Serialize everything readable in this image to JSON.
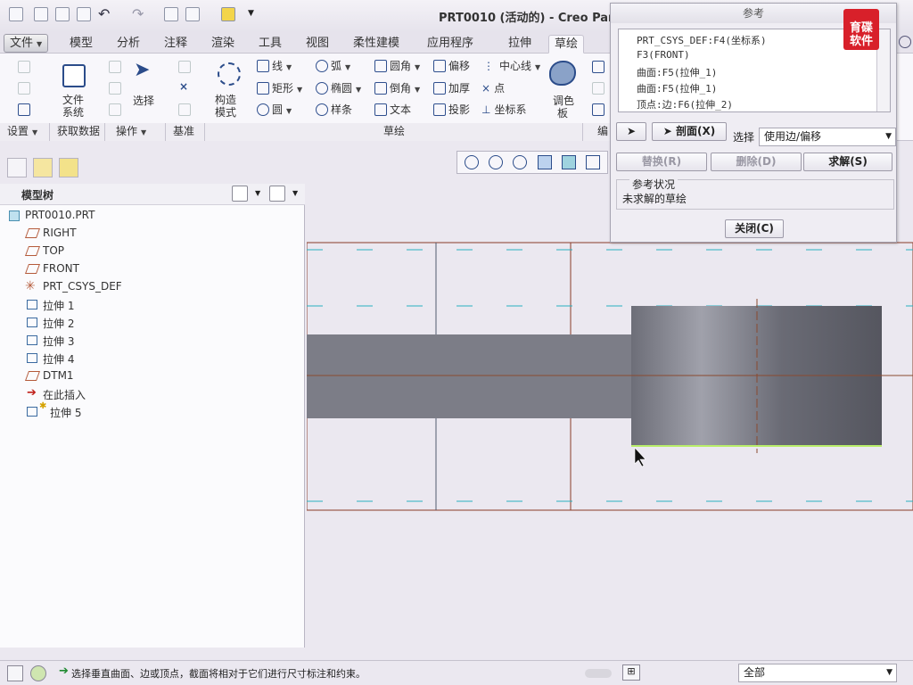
{
  "window": {
    "title": "PRT0010 (活动的) - Creo Parar"
  },
  "tabs": [
    {
      "label": "文件"
    },
    {
      "label": "模型"
    },
    {
      "label": "分析"
    },
    {
      "label": "注释"
    },
    {
      "label": "渲染"
    },
    {
      "label": "工具"
    },
    {
      "label": "视图"
    },
    {
      "label": "柔性建模"
    },
    {
      "label": "应用程序"
    },
    {
      "label": "拉伸"
    },
    {
      "label": "草绘"
    }
  ],
  "ribbon": {
    "file_system": "文件\n系统",
    "file_system_l1": "文件",
    "file_system_l2": "系统",
    "select": "选择",
    "construction_l1": "构造",
    "construction_l2": "模式",
    "line": "线",
    "rectangle": "矩形",
    "circle": "圆",
    "arc": "弧",
    "ellipse": "椭圆",
    "spline": "样条",
    "fillet": "圆角",
    "chamfer": "倒角",
    "text": "文本",
    "offset": "偏移",
    "thicken": "加厚",
    "project": "投影",
    "centerline": "中心线",
    "point": "点",
    "coordsys": "坐标系",
    "palette_l1": "调色",
    "palette_l2": "板",
    "groups": [
      "设置",
      "获取数据",
      "操作",
      "基准",
      "草绘",
      "编"
    ]
  },
  "model_tree": {
    "title": "模型树",
    "items": [
      "PRT0010.PRT",
      "RIGHT",
      "TOP",
      "FRONT",
      "PRT_CSYS_DEF",
      "拉伸 1",
      "拉伸 2",
      "拉伸 3",
      "拉伸 4",
      "DTM1",
      "在此插入",
      "拉伸 5"
    ]
  },
  "dialog": {
    "title": "参考",
    "references": [
      "PRT_CSYS_DEF:F4(坐标系)",
      "F3(FRONT)",
      "曲面:F5(拉伸_1)",
      "曲面:F5(拉伸_1)",
      "顶点:边:F6(拉伸_2)"
    ],
    "section_btn": "剖面(X)",
    "select_label": "选择",
    "select_value": "使用边/偏移",
    "replace_btn": "替换(R)",
    "delete_btn": "删除(D)",
    "solve_btn": "求解(S)",
    "status_label": "参考状况",
    "status_value": "未求解的草绘",
    "close_btn": "关闭(C)"
  },
  "logo": {
    "line1": "育碟",
    "line2": "软件"
  },
  "status": {
    "message": "选择垂直曲面、边或顶点，截面将相对于它们进行尺寸标注和约束。",
    "filter": "全部"
  },
  "colors": {
    "accent": "#2f4f8e",
    "datum": "#b45a3a",
    "logo": "#d8202a"
  }
}
